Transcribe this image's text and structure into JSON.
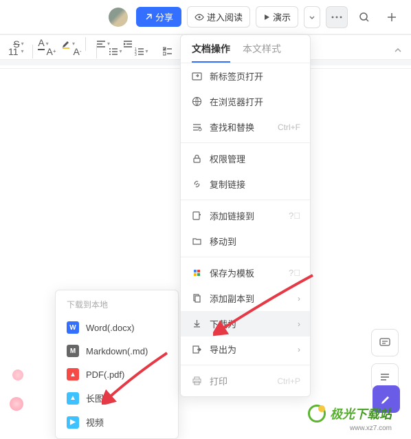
{
  "top": {
    "share": "分享",
    "read": "进入阅读",
    "present": "演示"
  },
  "fmt": {
    "fontsize": "11"
  },
  "dropdown": {
    "tab_doc": "文档操作",
    "tab_style": "本文样式",
    "items": {
      "new_tab": "新标签页打开",
      "browser": "在浏览器打开",
      "find": "查找和替换",
      "find_sc": "Ctrl+F",
      "perm": "权限管理",
      "copy_link": "复制链接",
      "add_link": "添加链接到",
      "move": "移动到",
      "save_tpl": "保存为模板",
      "add_copy": "添加副本到",
      "download": "下载为",
      "export": "导出为",
      "print": "打印",
      "print_sc": "Ctrl+P"
    }
  },
  "submenu": {
    "title": "下载到本地",
    "word": "Word(.docx)",
    "md": "Markdown(.md)",
    "pdf": "PDF(.pdf)",
    "img": "长图",
    "video": "视频"
  },
  "watermark": {
    "name": "极光下载站",
    "url": "www.xz7.com"
  }
}
